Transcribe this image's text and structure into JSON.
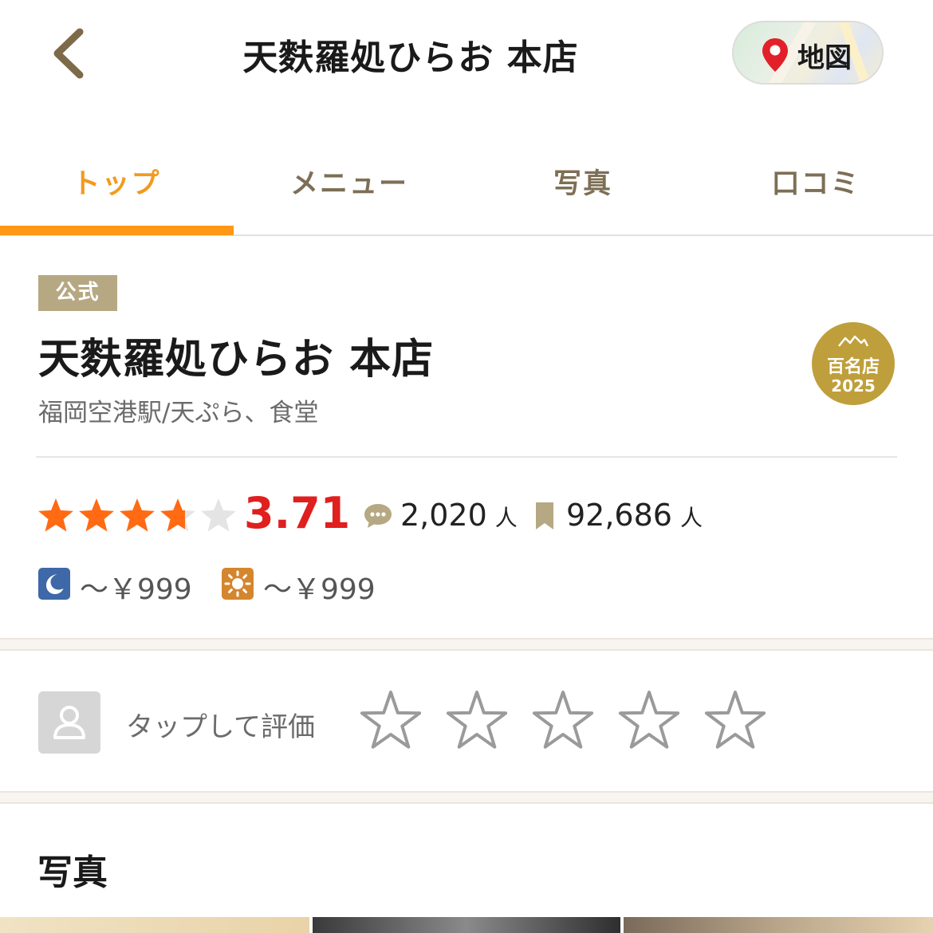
{
  "header": {
    "title": "天麩羅処ひらお 本店",
    "map_label": "地図"
  },
  "tabs": [
    {
      "label": "トップ",
      "active": true
    },
    {
      "label": "メニュー",
      "active": false
    },
    {
      "label": "写真",
      "active": false
    },
    {
      "label": "口コミ",
      "active": false
    }
  ],
  "shop": {
    "badge": "公式",
    "name": "天麩羅処ひらお 本店",
    "station_genre": "福岡空港駅/天ぷら、食堂",
    "award": {
      "label": "百名店",
      "year": "2025"
    }
  },
  "rating": {
    "value": "3.71",
    "stars": 3.71,
    "reviews": "2,020",
    "bookmarks": "92,686",
    "unit": "人"
  },
  "budget": {
    "dinner": "～￥999",
    "lunch": "～￥999"
  },
  "my_rating": {
    "prompt": "タップして評価",
    "star_count": 5
  },
  "photos": {
    "heading": "写真"
  },
  "colors": {
    "accent": "#ff9816",
    "rating_red": "#e01f1f",
    "star_orange": "#ff6a13",
    "tab_inactive": "#7d6f55",
    "gold": "#bf9f3b"
  }
}
